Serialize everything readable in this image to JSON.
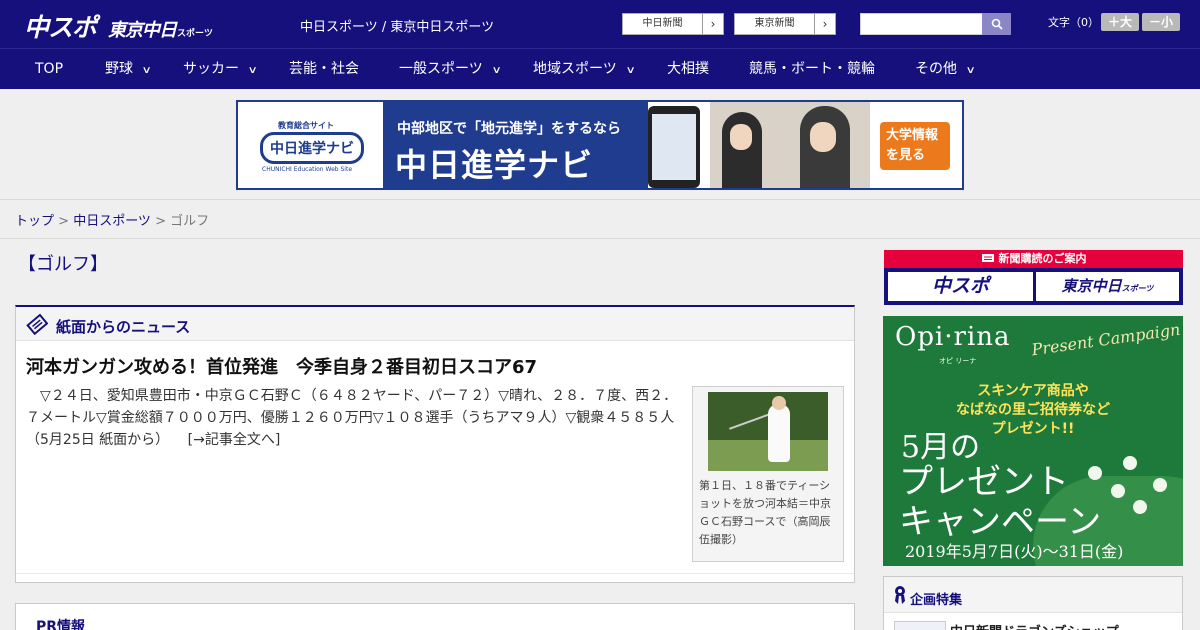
{
  "header": {
    "logo_main": "中スポ",
    "logo_secondary": "東京中日",
    "logo_secondary_small": "スポーツ",
    "site_title": "中日スポーツ / 東京中日スポーツ",
    "paper_links": [
      {
        "label": "中日新聞",
        "arrow": "›"
      },
      {
        "label": "東京新聞",
        "arrow": "›"
      }
    ],
    "search": {
      "value": "",
      "icon": "search-icon"
    },
    "font_size": {
      "label": "文字（0）",
      "bigger": "＋大",
      "smaller": "－小"
    }
  },
  "nav": {
    "items": [
      {
        "label": "TOP",
        "has_dropdown": false
      },
      {
        "label": "野球",
        "has_dropdown": true
      },
      {
        "label": "サッカー",
        "has_dropdown": true
      },
      {
        "label": "芸能・社会",
        "has_dropdown": false
      },
      {
        "label": "一般スポーツ",
        "has_dropdown": true
      },
      {
        "label": "地域スポーツ",
        "has_dropdown": true
      },
      {
        "label": "大相撲",
        "has_dropdown": false
      },
      {
        "label": "競馬・ボート・競輪",
        "has_dropdown": false
      },
      {
        "label": "その他",
        "has_dropdown": true
      }
    ],
    "chevron": "∨"
  },
  "top_banner": {
    "logo_small": "教育総合サイト",
    "logo": "中日進学ナビ",
    "logo_sub": "CHUNICHI Education Web Site",
    "tagline": "中部地区で「地元進学」をするなら",
    "title": "中日進学ナビ",
    "cta_line1": "大学情報",
    "cta_line2": "を見る"
  },
  "breadcrumb": {
    "home": "トップ",
    "sep": " > ",
    "section": "中日スポーツ",
    "current": "ゴルフ"
  },
  "main": {
    "page_title": "【ゴルフ】",
    "news_section_label": "紙面からのニュース",
    "article": {
      "title": "河本ガンガン攻める！首位発進　今季自身２番目初日スコア67",
      "body": "　▽２４日、愛知県豊田市・中京ＧＣ石野Ｃ（６４８２ヤード、パー７２）▽晴れ、２８．７度、西２．７メートル▽賞金総額７０００万円、優勝１２６０万円▽１０８選手（うちアマ９人）▽観衆４５８５人（5月25日 紙面から）",
      "more_link": "[→記事全文へ]",
      "photo_caption": "第１日、１８番でティーショットを放つ河本結＝中京ＧＣ石野コースで（高岡辰伍撮影）"
    },
    "pr_label": "PR情報"
  },
  "sidebar": {
    "subscription": {
      "header": "新聞購読のご案内",
      "btn1": "中スポ",
      "btn2": "東京中日",
      "btn2_small": "スポーツ"
    },
    "ad": {
      "brand": "Opi·rina",
      "brand_sub": "オピ リーナ",
      "script": "Present Campaign",
      "line1": "スキンケア商品や",
      "line2": "なばなの里ご招待券など",
      "line3": "プレゼント!!",
      "big1": "5月の",
      "big2": "プレゼント",
      "big3": "キャンペーン",
      "dates": "2019年5月7日(火)～31日(金)"
    },
    "features": {
      "label": "企画特集",
      "item": "中日新聞ドラゴンズショップ"
    }
  },
  "colors": {
    "brand_navy": "#16107c",
    "subscription_red": "#e6003c",
    "banner_blue": "#1f3c8e",
    "cta_orange": "#ec7a1c",
    "ad_green": "#1d7a3a"
  }
}
